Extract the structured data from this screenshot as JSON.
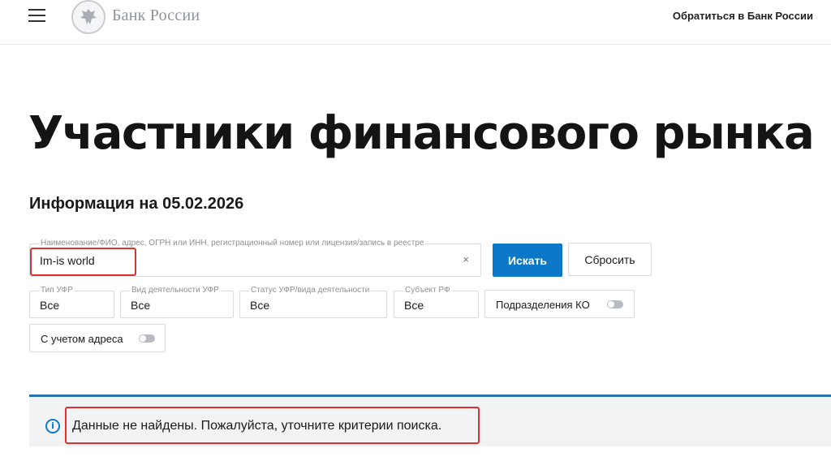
{
  "header": {
    "logo_text": "Банк России",
    "contact_link": "Обратиться в Банк России"
  },
  "page": {
    "title": "Участники финансового рынка",
    "info_date": "Информация на 05.02.2026"
  },
  "search": {
    "label": "Наименование/ФИО, адрес, ОГРН или ИНН, регистрационный номер или лицензия/запись в реестре",
    "value": "Im-is world",
    "clear_glyph": "×",
    "search_button": "Искать",
    "reset_button": "Сбросить"
  },
  "filters": {
    "type": {
      "label": "Тип УФР",
      "value": "Все"
    },
    "activity": {
      "label": "Вид деятельности УФР",
      "value": "Все"
    },
    "status": {
      "label": "Статус УФР/вида деятельности",
      "value": "Все"
    },
    "subject": {
      "label": "Субъект РФ",
      "value": "Все"
    },
    "ko_toggle": {
      "label": "Подразделения КО",
      "on": false
    },
    "address_toggle": {
      "label": "С учетом адреса",
      "on": false
    }
  },
  "notice": {
    "icon": "info-icon",
    "icon_glyph": "i",
    "text": "Данные не найдены. Пожалуйста, уточните критерии поиска."
  },
  "colors": {
    "accent": "#0d78c8",
    "highlight": "#e03131",
    "notice_border": "#2b73b2"
  }
}
